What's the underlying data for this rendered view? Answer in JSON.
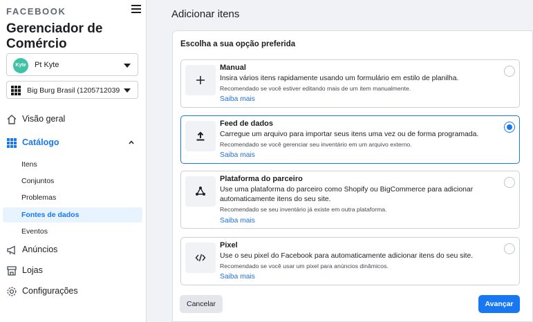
{
  "sidebar": {
    "brand": "FACEBOOK",
    "app_title": "Gerenciador de Comércio",
    "account": {
      "avatar_text": "Kyte",
      "name": "Pt Kyte"
    },
    "catalog_selector": {
      "text": "Big Burg Brasil (1205712039..."
    },
    "nav": {
      "overview": "Visão geral",
      "catalog": "Catálogo",
      "catalog_sub": [
        "Itens",
        "Conjuntos",
        "Problemas",
        "Fontes de dados",
        "Eventos"
      ],
      "ads": "Anúncios",
      "shops": "Lojas",
      "settings": "Configurações"
    }
  },
  "main": {
    "title": "Adicionar itens",
    "subtitle": "Escolha a sua opção preferida",
    "options": [
      {
        "title": "Manual",
        "desc": "Insira vários itens rapidamente usando um formulário em estilo de planilha.",
        "rec": "Recomendado se você estiver editando mais de um item manualmente.",
        "more": "Saiba mais",
        "icon": "plus-icon",
        "selected": false
      },
      {
        "title": "Feed de dados",
        "desc": "Carregue um arquivo para importar seus itens uma vez ou de forma programada.",
        "rec": "Recomendado se você gerenciar seu inventário em um arquivo externo.",
        "more": "Saiba mais",
        "icon": "upload-icon",
        "selected": true
      },
      {
        "title": "Plataforma do parceiro",
        "desc": "Use uma plataforma do parceiro como Shopify ou BigCommerce para adicionar automaticamente itens do seu site.",
        "rec": "Recomendado se seu inventário já existe em outra plataforma.",
        "more": "Saiba mais",
        "icon": "partner-network-icon",
        "selected": false
      },
      {
        "title": "Pixel",
        "desc": "Use o seu pixel do Facebook para automaticamente adicionar itens do seu site.",
        "rec": "Recomendado se você usar um pixel para anúncios dinâmicos.",
        "more": "Saiba mais",
        "icon": "code-icon",
        "selected": false
      }
    ],
    "cancel_label": "Cancelar",
    "next_label": "Avançar"
  },
  "colors": {
    "accent": "#1877f2",
    "selected_bg": "#e7f3ff",
    "avatar": "#3fc3a4"
  }
}
